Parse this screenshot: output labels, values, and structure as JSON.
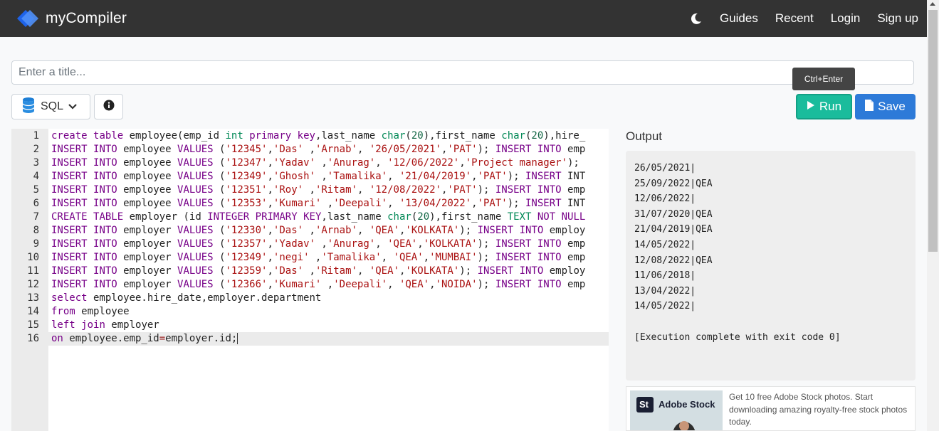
{
  "navbar": {
    "brand": "myCompiler",
    "links": [
      "Guides",
      "Recent",
      "Login",
      "Sign up"
    ],
    "theme_icon": "moon-icon"
  },
  "title_input": {
    "placeholder": "Enter a title...",
    "value": ""
  },
  "toolbar": {
    "language": "SQL",
    "language_icon": "database-icon",
    "info_icon": "info-icon",
    "tooltip": "Ctrl+Enter",
    "run_label": "Run",
    "save_label": "Save"
  },
  "editor": {
    "active_line": 16,
    "lines": [
      "create table employee(emp_id int primary key,last_name char(20),first_name char(20),hire_",
      "INSERT INTO employee VALUES ('12345','Das' ,'Arnab', '26/05/2021','PAT'); INSERT INTO emp",
      "INSERT INTO employee VALUES ('12347','Yadav' ,'Anurag', '12/06/2022','Project manager'); ",
      "INSERT INTO employee VALUES ('12349','Ghosh' ,'Tamalika', '21/04/2019','PAT'); INSERT INT",
      "INSERT INTO employee VALUES ('12351','Roy' ,'Ritam', '12/08/2022','PAT'); INSERT INTO emp",
      "INSERT INTO employee VALUES ('12353','Kumari' ,'Deepali', '13/04/2022','PAT'); INSERT INT",
      "CREATE TABLE employer (id INTEGER PRIMARY KEY,last_name char(20),first_name TEXT NOT NULL",
      "INSERT INTO employer VALUES ('12330','Das' ,'Arnab', 'QEA','KOLKATA'); INSERT INTO employ",
      "INSERT INTO employer VALUES ('12357','Yadav' ,'Anurag', 'QEA','KOLKATA'); INSERT INTO emp",
      "INSERT INTO employer VALUES ('12349','negi' ,'Tamalika', 'QEA','MUMBAI'); INSERT INTO emp",
      "INSERT INTO employer VALUES ('12359','Das' ,'Ritam', 'QEA','KOLKATA'); INSERT INTO employ",
      "INSERT INTO employer VALUES ('12366','Kumari' ,'Deepali', 'QEA','NOIDA'); INSERT INTO emp",
      "select employee.hire_date,employer.department",
      "from employee",
      "left join employer",
      "on employee.emp_id=employer.id;"
    ]
  },
  "output": {
    "title": "Output",
    "lines": [
      "26/05/2021|",
      "25/09/2022|QEA",
      "12/06/2022|",
      "31/07/2020|QEA",
      "21/04/2019|QEA",
      "14/05/2022|",
      "12/08/2022|QEA",
      "11/06/2018|",
      "13/04/2022|",
      "14/05/2022|",
      "",
      "[Execution complete with exit code 0]"
    ]
  },
  "ad": {
    "brand": "Adobe Stock",
    "badge": "St",
    "text": "Get 10 free Adobe Stock photos. Start downloading amazing royalty-free stock photos today."
  },
  "colors": {
    "navbar": "#333333",
    "run": "#1abc9c",
    "save": "#2d7ad8",
    "keyword": "#770088",
    "type": "#008855",
    "string": "#aa1111",
    "number": "#116644"
  }
}
